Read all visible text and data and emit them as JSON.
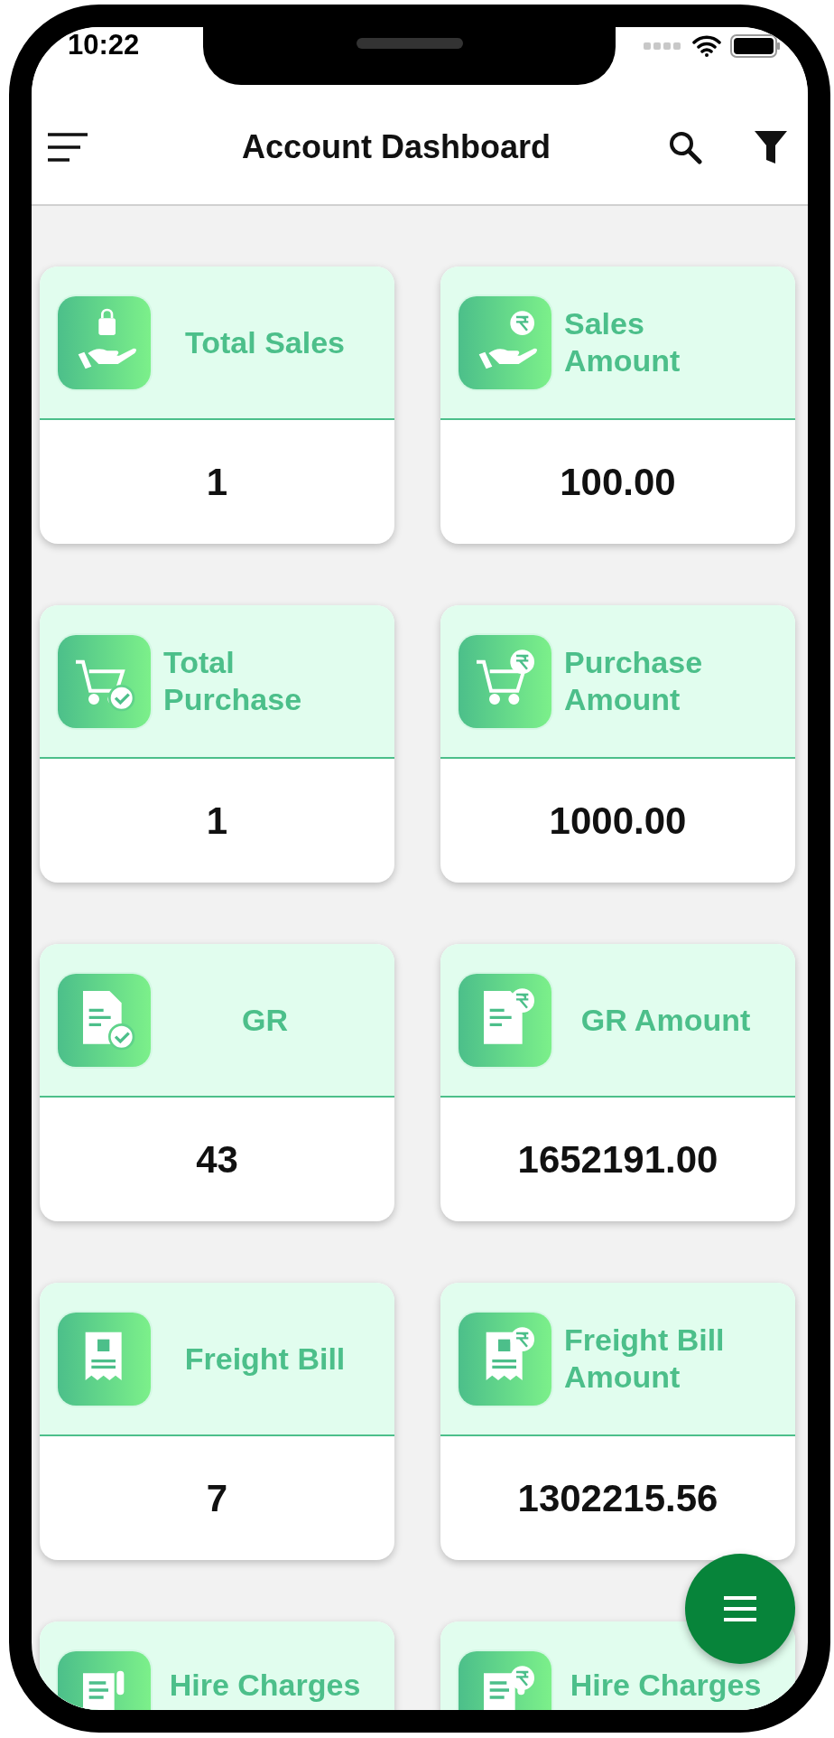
{
  "status_bar": {
    "time": "10:22"
  },
  "header": {
    "title": "Account Dashboard"
  },
  "cards": [
    {
      "title": "Total Sales",
      "value": "1"
    },
    {
      "title": "Sales Amount",
      "value": "100.00"
    },
    {
      "title": "Total Purchase",
      "value": "1"
    },
    {
      "title": "Purchase Amount",
      "value": "1000.00"
    },
    {
      "title": "GR",
      "value": "43"
    },
    {
      "title": "GR Amount",
      "value": "1652191.00"
    },
    {
      "title": "Freight Bill",
      "value": "7"
    },
    {
      "title": "Freight Bill Amount",
      "value": "1302215.56"
    },
    {
      "title": "Hire Charges"
    },
    {
      "title": "Hire Charges"
    }
  ]
}
